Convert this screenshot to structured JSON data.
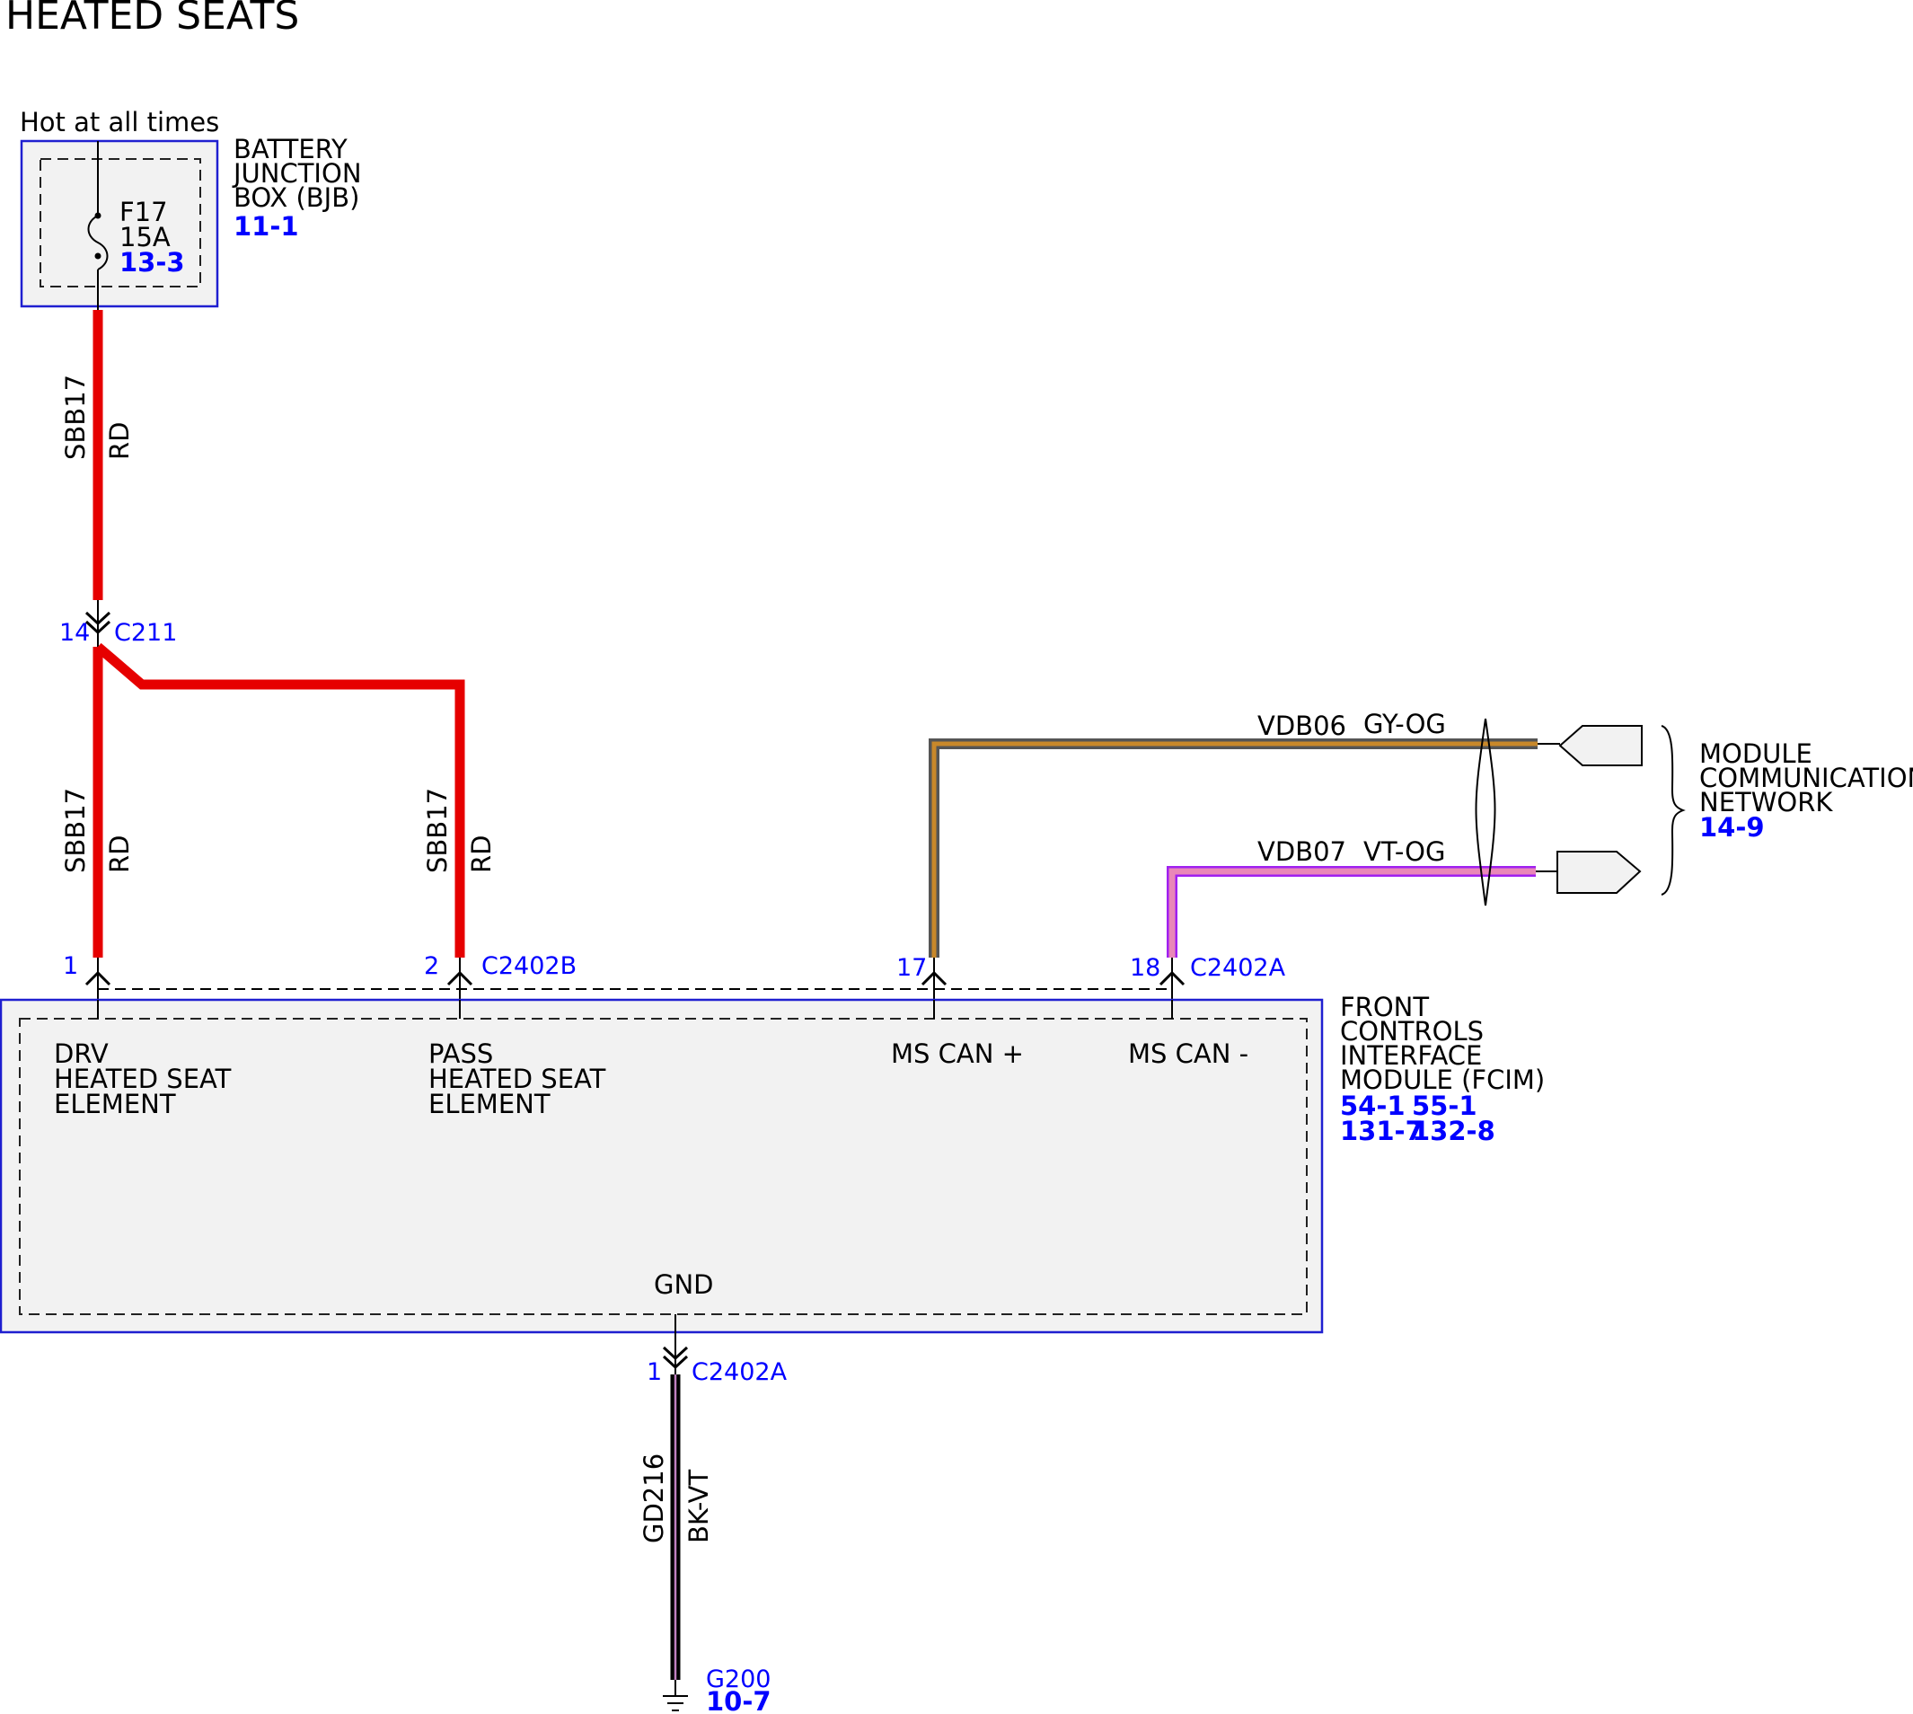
{
  "title": "HEATED SEATS",
  "colors": {
    "wire_red": "#e60000",
    "ref_blue": "#0000ff",
    "module_fill": "#f2f2f2",
    "module_border": "#1f1fd0",
    "gy_og_core": "#c8882a",
    "gy_og_edge": "#555555",
    "vt_og_core": "#e987b8",
    "vt_og_edge": "#a020f0",
    "bk_vt_edge": "#000000",
    "bk_vt_stripe": "#c080c0"
  },
  "bjb": {
    "supply_label": "Hot at all times",
    "name_lines": [
      "BATTERY",
      "JUNCTION",
      "BOX (BJB)"
    ],
    "ref": "11-1",
    "fuse_name": "F17",
    "fuse_rating": "15A",
    "fuse_ref": "13-3"
  },
  "wires": {
    "sbb17_circuit": "SBB17",
    "sbb17_color": "RD",
    "vdb06_circuit": "VDB06",
    "vdb06_color": "GY-OG",
    "vdb07_circuit": "VDB07",
    "vdb07_color": "VT-OG",
    "gd216_circuit": "GD216",
    "gd216_color": "BK-VT"
  },
  "connectors": {
    "c211_pin": "14",
    "c211_name": "C211",
    "drv_pin": "1",
    "pass_pin": "2",
    "c2402b_name": "C2402B",
    "mscan_plus_pin": "17",
    "mscan_minus_pin": "18",
    "c2402a_name": "C2402A",
    "gnd_pin": "1",
    "gnd_conn_name": "C2402A"
  },
  "fcim": {
    "name_lines": [
      "FRONT",
      "CONTROLS",
      "INTERFACE",
      "MODULE (FCIM)"
    ],
    "refs_row1": [
      "54-1",
      "55-1"
    ],
    "refs_row2": [
      "131-7",
      "132-8"
    ],
    "drv_lines": [
      "DRV",
      "HEATED SEAT",
      "ELEMENT"
    ],
    "pass_lines": [
      "PASS",
      "HEATED SEAT",
      "ELEMENT"
    ],
    "mscan_plus": "MS CAN +",
    "mscan_minus": "MS CAN -",
    "gnd": "GND"
  },
  "network": {
    "name_lines": [
      "MODULE",
      "COMMUNICATIONS",
      "NETWORK"
    ],
    "ref": "14-9"
  },
  "ground": {
    "name": "G200",
    "ref": "10-7"
  }
}
